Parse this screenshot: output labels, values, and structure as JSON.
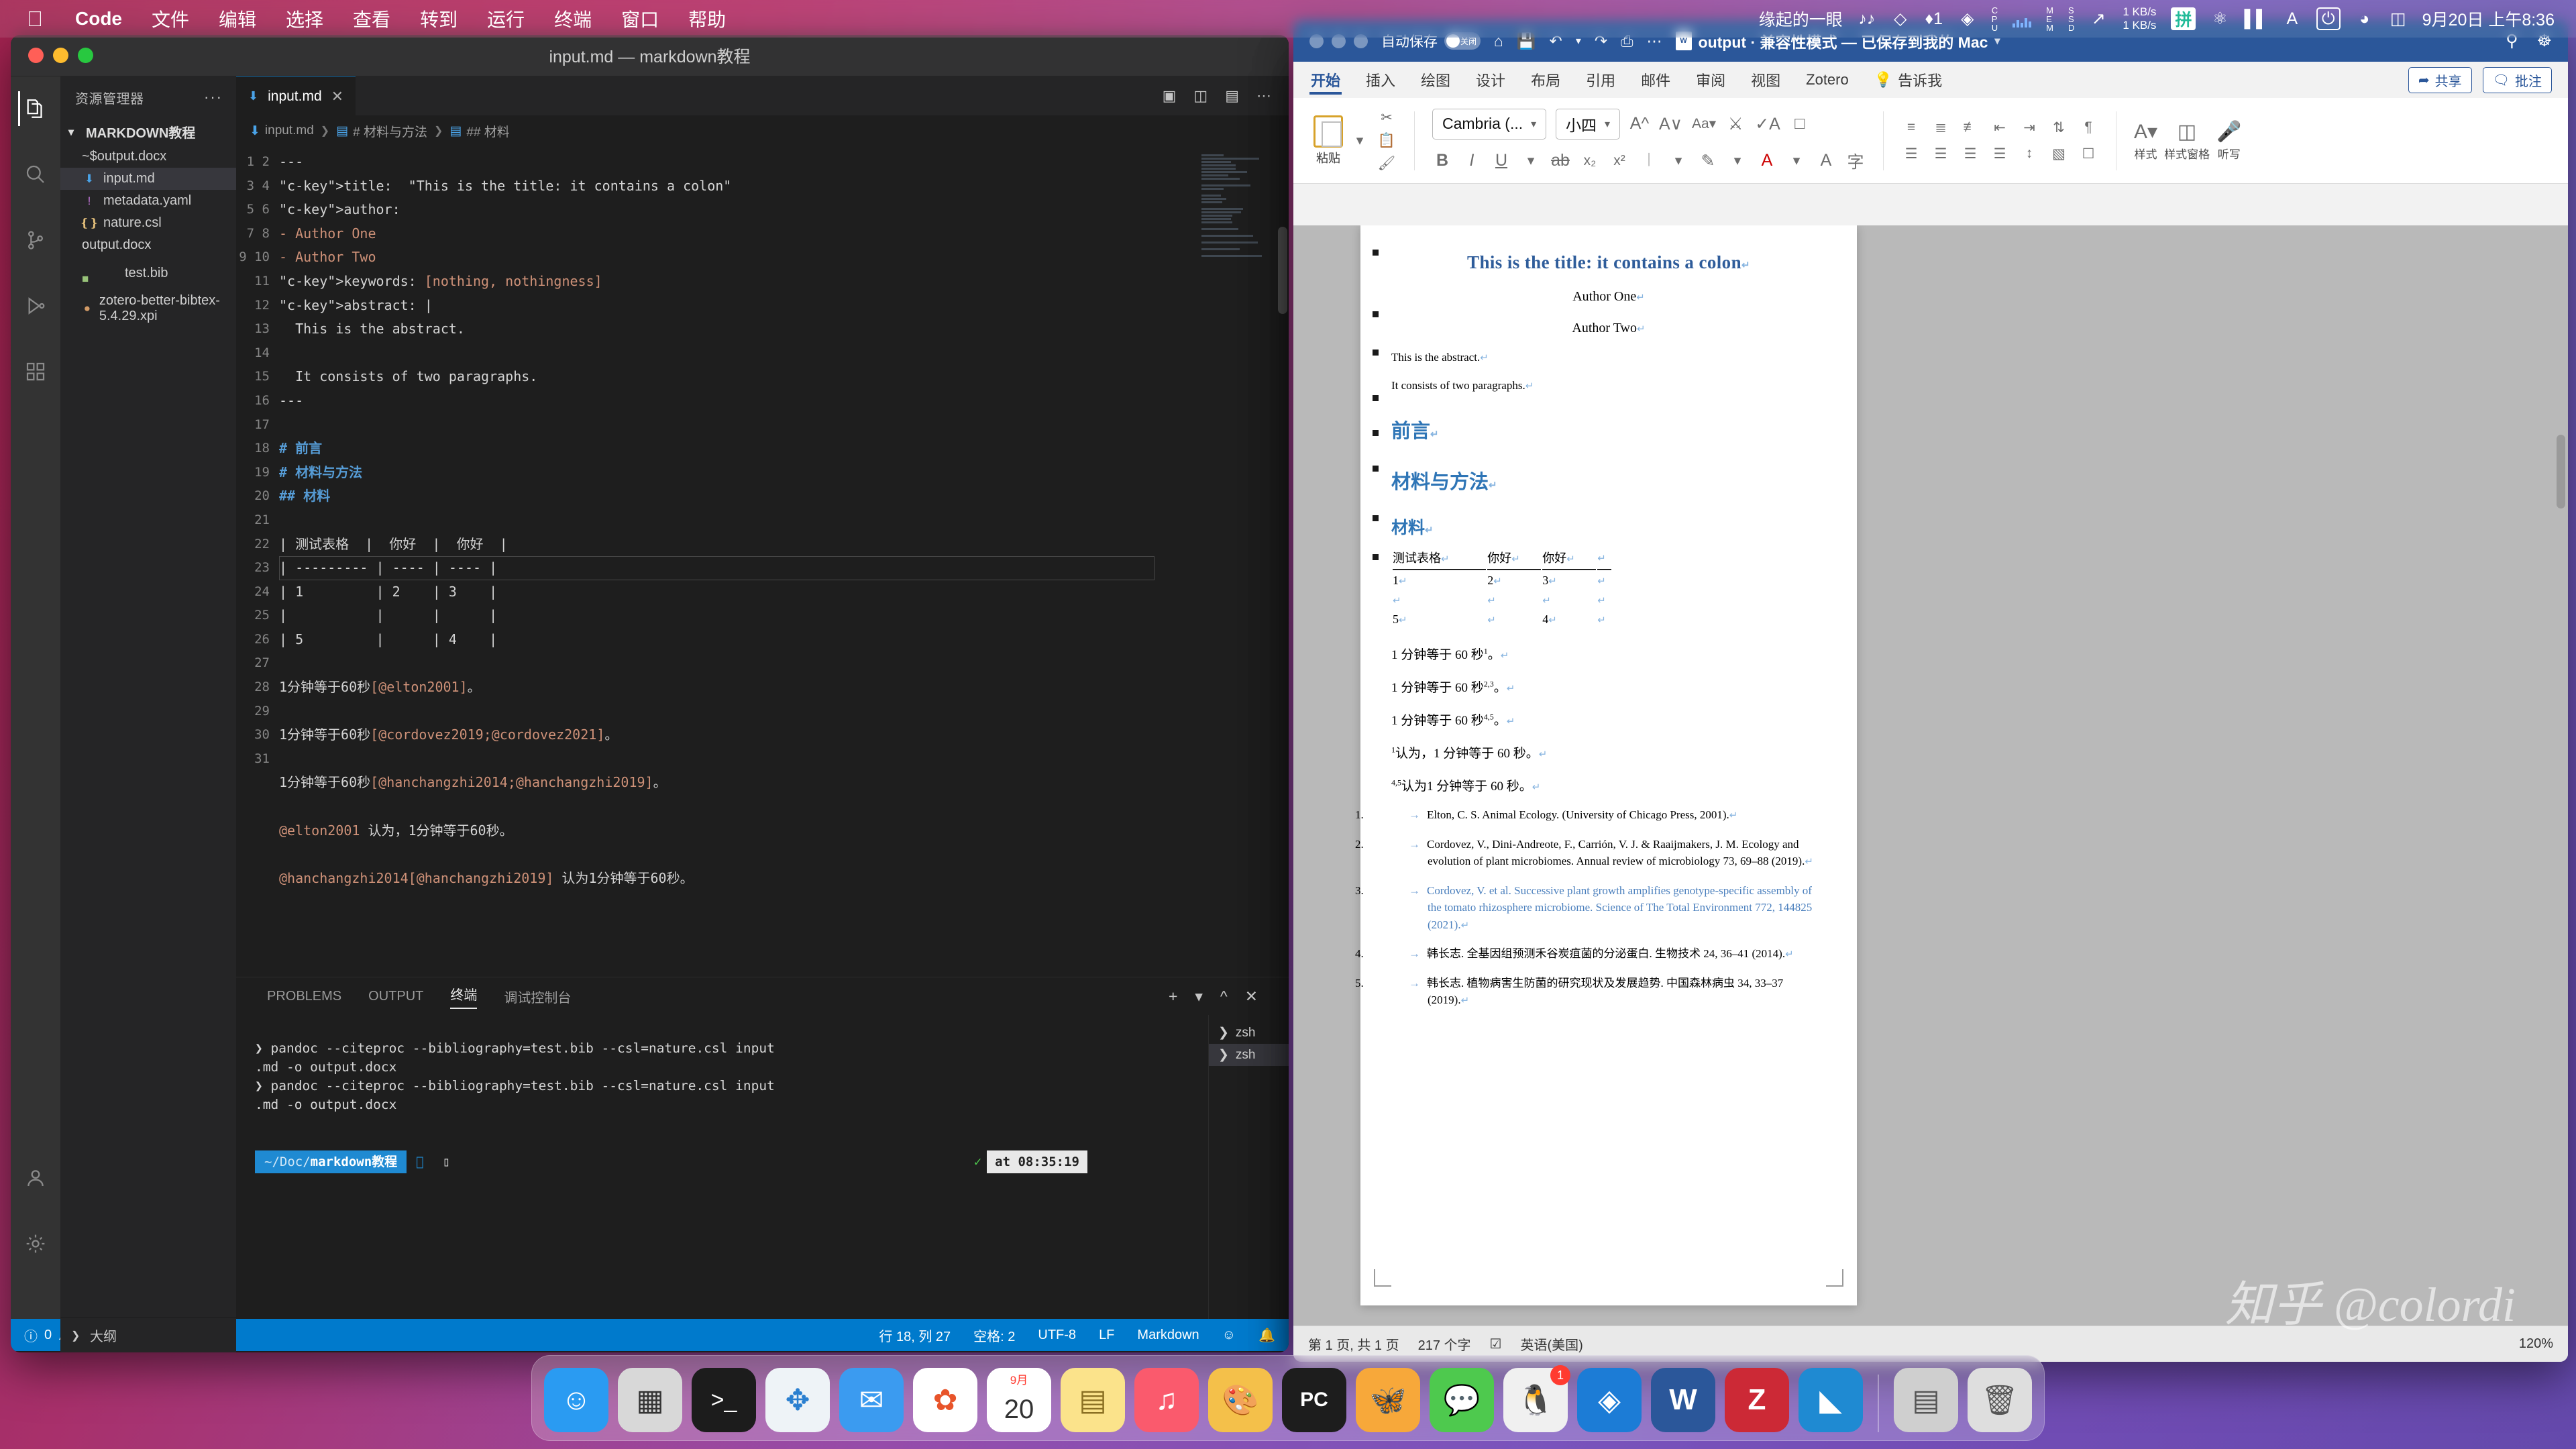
{
  "menubar": {
    "apple_icon": "apple-icon",
    "items": [
      "Code",
      "文件",
      "编辑",
      "选择",
      "查看",
      "转到",
      "运行",
      "终端",
      "窗口",
      "帮助"
    ],
    "status": {
      "user": "缘起的一眼",
      "network_up": "1 KB/s",
      "network_down": "1 KB/s",
      "cpu_label": "CPU",
      "mem_label": "MEM",
      "ssd_label": "SSD",
      "battery": "charging-icon",
      "datetime": "9月20日 上午8:36"
    }
  },
  "vscode": {
    "window_title": "input.md — markdown教程",
    "activity_bar": [
      "explorer-icon",
      "search-icon",
      "source-control-icon",
      "run-debug-icon",
      "extensions-icon",
      "account-icon",
      "settings-icon"
    ],
    "sidebar": {
      "header": "资源管理器",
      "more": "···",
      "folder": "MARKDOWN教程",
      "files": [
        {
          "name": "~$output.docx",
          "icon": "word-file-icon",
          "selected": false
        },
        {
          "name": "input.md",
          "icon": "markdown-file-icon",
          "selected": true
        },
        {
          "name": "metadata.yaml",
          "icon": "yaml-file-icon",
          "selected": false
        },
        {
          "name": "nature.csl",
          "icon": "csl-file-icon",
          "selected": false
        },
        {
          "name": "output.docx",
          "icon": "word-file-icon",
          "selected": false
        },
        {
          "name": "test.bib",
          "icon": "bib-file-icon",
          "selected": false
        },
        {
          "name": "zotero-better-bibtex-5.4.29.xpi",
          "icon": "xpi-file-icon",
          "selected": false
        }
      ],
      "outline": "大纲"
    },
    "tab": {
      "label": "input.md",
      "close": "✕"
    },
    "breadcrumb": [
      "input.md",
      "# 材料与方法",
      "## 材料"
    ],
    "editor_lines": [
      {
        "n": 1,
        "text": "---"
      },
      {
        "n": 2,
        "text": "title:  \"This is the title: it contains a colon\""
      },
      {
        "n": 3,
        "text": "author:"
      },
      {
        "n": 4,
        "text": "- Author One"
      },
      {
        "n": 5,
        "text": "- Author Two"
      },
      {
        "n": 6,
        "text": "keywords: [nothing, nothingness]"
      },
      {
        "n": 7,
        "text": "abstract: |"
      },
      {
        "n": 8,
        "text": "  This is the abstract."
      },
      {
        "n": 9,
        "text": ""
      },
      {
        "n": 10,
        "text": "  It consists of two paragraphs."
      },
      {
        "n": 11,
        "text": "---"
      },
      {
        "n": 12,
        "text": ""
      },
      {
        "n": 13,
        "text": "# 前言"
      },
      {
        "n": 14,
        "text": "# 材料与方法"
      },
      {
        "n": 15,
        "text": "## 材料"
      },
      {
        "n": 16,
        "text": ""
      },
      {
        "n": 17,
        "text": "| 测试表格  |  你好  |  你好  |"
      },
      {
        "n": 18,
        "text": "| --------- | ---- | ---- |"
      },
      {
        "n": 19,
        "text": "| 1         | 2    | 3    |"
      },
      {
        "n": 20,
        "text": "|           |      |      |"
      },
      {
        "n": 21,
        "text": "| 5         |      | 4    |"
      },
      {
        "n": 22,
        "text": ""
      },
      {
        "n": 23,
        "text": "1分钟等于60秒[@elton2001]。"
      },
      {
        "n": 24,
        "text": ""
      },
      {
        "n": 25,
        "text": "1分钟等于60秒[@cordovez2019;@cordovez2021]。"
      },
      {
        "n": 26,
        "text": ""
      },
      {
        "n": 27,
        "text": "1分钟等于60秒[@hanchangzhi2014;@hanchangzhi2019]。"
      },
      {
        "n": 28,
        "text": ""
      },
      {
        "n": 29,
        "text": "@elton2001 认为，1分钟等于60秒。"
      },
      {
        "n": 30,
        "text": ""
      },
      {
        "n": 31,
        "text": "@hanchangzhi2014[@hanchangzhi2019] 认为1分钟等于60秒。"
      }
    ],
    "panel": {
      "tabs": [
        "PROBLEMS",
        "OUTPUT",
        "终端",
        "调试控制台"
      ],
      "active_tab": "终端",
      "terminal_lines": [
        "❯ pandoc --citeproc --bibliography=test.bib --csl=nature.csl input",
        ".md -o output.docx",
        "❯ pandoc --citeproc --bibliography=test.bib --csl=nature.csl input",
        ".md -o output.docx"
      ],
      "prompt_path_dim": "~/Doc/",
      "prompt_path_bold": "markdown教程",
      "prompt_ok": "✓",
      "prompt_time": "at 08:35:19",
      "terminal_list": [
        {
          "label": "zsh",
          "selected": false
        },
        {
          "label": "zsh",
          "selected": true
        }
      ]
    },
    "statusbar": {
      "errors": "0",
      "warnings": "0",
      "cursor": "行 18, 列 27",
      "spaces": "空格: 2",
      "encoding": "UTF-8",
      "eol": "LF",
      "language": "Markdown",
      "feedback_icon": "feedback-icon",
      "bell_icon": "bell-icon"
    }
  },
  "word": {
    "titlebar": {
      "autosave_label": "自动保存",
      "autosave_state": "关闭",
      "quick_access": [
        "home-icon",
        "save-icon",
        "undo-icon",
        "redo-icon",
        "print-icon",
        "more-icon"
      ],
      "doc_title": "output · 兼容性模式 — 已保存到我的 Mac",
      "search_icon": "search-icon",
      "collab_icon": "collaborators-icon"
    },
    "ribbon_tabs": [
      "开始",
      "插入",
      "绘图",
      "设计",
      "布局",
      "引用",
      "邮件",
      "审阅",
      "视图",
      "Zotero",
      "告诉我"
    ],
    "active_ribbon_tab": "开始",
    "ribbon_right": [
      {
        "label": "共享",
        "icon": "share-icon"
      },
      {
        "label": "批注",
        "icon": "comment-icon"
      }
    ],
    "ribbon": {
      "paste_label": "粘贴",
      "font_name": "Cambria (...",
      "font_size": "小四",
      "dictate_label": "听写",
      "styles_label": "样式",
      "styles_pane_label": "样式窗格"
    },
    "document": {
      "title": "This is the title: it contains a colon",
      "authors": [
        "Author One",
        "Author Two"
      ],
      "abstract_paragraphs": [
        "This is the abstract.",
        "It consists of two paragraphs."
      ],
      "heading_1": "前言",
      "heading_2": "材料与方法",
      "heading_3": "材料",
      "table": {
        "headers": [
          "测试表格",
          "你好",
          "你好"
        ],
        "rows": [
          [
            "1",
            "2",
            "3"
          ],
          [
            "",
            "",
            ""
          ],
          [
            "5",
            "",
            "4"
          ]
        ]
      },
      "body_lines": [
        {
          "text": "1 分钟等于 60 秒",
          "sup": "1",
          "tail": "。"
        },
        {
          "text": "1 分钟等于 60 秒",
          "sup": "2,3",
          "tail": "。"
        },
        {
          "text": "1 分钟等于 60 秒",
          "sup": "4,5",
          "tail": "。"
        },
        {
          "sup_lead": "1",
          "text": "认为，1 分钟等于 60 秒。",
          "tail": ""
        },
        {
          "sup_lead": "4,5",
          "text": "认为1 分钟等于 60 秒。",
          "tail": ""
        }
      ],
      "bibliography": [
        {
          "num": "1.",
          "text": "Elton, C. S. Animal Ecology. (University of Chicago Press, 2001)."
        },
        {
          "num": "2.",
          "text": "Cordovez, V., Dini-Andreote, F., Carrión, V. J. & Raaijmakers, J. M. Ecology and evolution of plant microbiomes. Annual review of microbiology 73, 69–88 (2019)."
        },
        {
          "num": "3.",
          "text": "Cordovez, V. et al. Successive plant growth amplifies genotype-specific assembly of the tomato rhizosphere microbiome. Science of The Total Environment 772, 144825 (2021)."
        },
        {
          "num": "4.",
          "text": "韩长志. 全基因组预测禾谷炭疽菌的分泌蛋白. 生物技术 24, 36–41 (2014)."
        },
        {
          "num": "5.",
          "text": "韩长志. 植物病害生防菌的研究现状及发展趋势. 中国森林病虫 34, 33–37 (2019)."
        }
      ]
    },
    "statusbar": {
      "page": "第 1 页, 共 1 页",
      "words": "217 个字",
      "proofing_icon": "proofing-icon",
      "language": "英语(美国)",
      "zoom": "120%"
    }
  },
  "watermark": "知乎 @colordi",
  "dock": {
    "items": [
      {
        "name": "finder",
        "glyph": "🙂",
        "color": "#2a9bf2"
      },
      {
        "name": "launchpad",
        "glyph": "▦",
        "color": "#d8d8d8"
      },
      {
        "name": "terminal",
        "glyph": ">_",
        "color": "#1c1c1c"
      },
      {
        "name": "safari",
        "glyph": "🧭",
        "color": "#f0f0f0"
      },
      {
        "name": "mail",
        "glyph": "✉",
        "color": "#3b9bf0"
      },
      {
        "name": "photos",
        "glyph": "✿",
        "color": "#ffffff"
      },
      {
        "name": "calendar",
        "glyph": "20",
        "month": "9月",
        "color": "#ffffff"
      },
      {
        "name": "notes",
        "glyph": "▤",
        "color": "#fbe38b"
      },
      {
        "name": "music",
        "glyph": "♪",
        "color": "#fa5a6d"
      },
      {
        "name": "preview",
        "glyph": "🎨",
        "color": "#f4c04a"
      },
      {
        "name": "pycharm",
        "glyph": "PC",
        "color": "#1d1d1d"
      },
      {
        "name": "butterfly-app",
        "glyph": "🦋",
        "color": "#f7a83a"
      },
      {
        "name": "wechat",
        "glyph": "💬",
        "color": "#4ec94e"
      },
      {
        "name": "qq",
        "glyph": "🐧",
        "color": "#f0f0f0",
        "badge": "1"
      },
      {
        "name": "sourcetree",
        "glyph": "◈",
        "color": "#1c7cd6"
      },
      {
        "name": "word",
        "glyph": "W",
        "color": "#2b579a"
      },
      {
        "name": "zotero",
        "glyph": "Z",
        "color": "#cc2936"
      },
      {
        "name": "vscode",
        "glyph": "◣",
        "color": "#1f8ad2"
      },
      {
        "name": "downloads",
        "glyph": "▤",
        "color": "#cfcfcf"
      },
      {
        "name": "trash",
        "glyph": "🗑",
        "color": "#dedede"
      }
    ]
  }
}
